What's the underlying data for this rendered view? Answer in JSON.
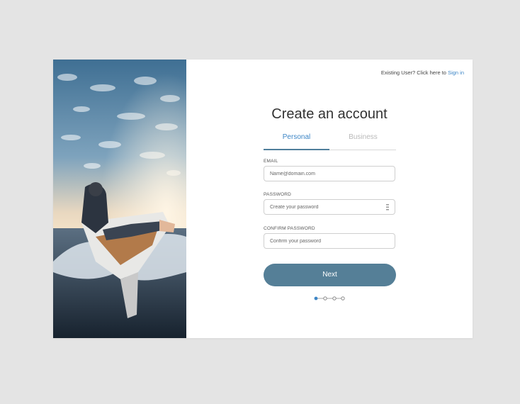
{
  "header": {
    "existing_user_text": "Existing User? Click here to",
    "sign_in_link": "Sign in"
  },
  "form": {
    "title": "Create an account",
    "tabs": [
      {
        "label": "Personal",
        "active": true
      },
      {
        "label": "Business",
        "active": false
      }
    ],
    "fields": {
      "email": {
        "label": "EMAIL",
        "placeholder": "Name@domain.com"
      },
      "password": {
        "label": "PASSWORD",
        "placeholder": "Create your password"
      },
      "confirm_password": {
        "label": "CONFIRM PASSWORD",
        "placeholder": "Confirm your password"
      }
    },
    "next_button": "Next",
    "progress": {
      "total_steps": 4,
      "current_step": 1
    }
  },
  "colors": {
    "accent": "#3d86c6",
    "button": "#557f97",
    "background": "#e4e4e4"
  }
}
